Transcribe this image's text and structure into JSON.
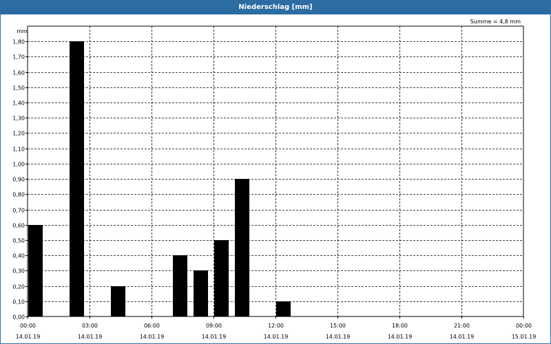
{
  "window": {
    "title": "Niederschlag [mm]"
  },
  "chart_data": {
    "type": "bar",
    "title": "Niederschlag [mm]",
    "annotation": "Summe = 4,8 mm",
    "ylabel": "mm",
    "ylim": [
      0,
      1.9
    ],
    "y_ticks": [
      "0,00",
      "0,10",
      "0,20",
      "0,30",
      "0,40",
      "0,50",
      "0,60",
      "0,70",
      "0,80",
      "0,90",
      "1,00",
      "1,10",
      "1,20",
      "1,30",
      "1,40",
      "1,50",
      "1,60",
      "1,70",
      "1,80"
    ],
    "y_tick_values": [
      0,
      0.1,
      0.2,
      0.3,
      0.4,
      0.5,
      0.6,
      0.7,
      0.8,
      0.9,
      1.0,
      1.1,
      1.2,
      1.3,
      1.4,
      1.5,
      1.6,
      1.7,
      1.8
    ],
    "x_range_hours": [
      0,
      24
    ],
    "x_ticks": [
      {
        "hour": 0,
        "time": "00:00",
        "date": "14.01.19"
      },
      {
        "hour": 3,
        "time": "03:00",
        "date": "14.01.19"
      },
      {
        "hour": 6,
        "time": "06:00",
        "date": "14.01.19"
      },
      {
        "hour": 9,
        "time": "09:00",
        "date": "14.01.19"
      },
      {
        "hour": 12,
        "time": "12:00",
        "date": "14.01.19"
      },
      {
        "hour": 15,
        "time": "15:00",
        "date": "14.01.19"
      },
      {
        "hour": 18,
        "time": "18:00",
        "date": "14.01.19"
      },
      {
        "hour": 21,
        "time": "21:00",
        "date": "14.01.19"
      },
      {
        "hour": 24,
        "time": "00:00",
        "date": "15.01.19"
      }
    ],
    "bars": [
      {
        "hour": 0,
        "value": 0.6
      },
      {
        "hour": 2,
        "value": 1.8
      },
      {
        "hour": 4,
        "value": 0.2
      },
      {
        "hour": 7,
        "value": 0.4
      },
      {
        "hour": 8,
        "value": 0.3
      },
      {
        "hour": 9,
        "value": 0.5
      },
      {
        "hour": 10,
        "value": 0.9
      },
      {
        "hour": 12,
        "value": 0.1
      }
    ],
    "grid": true,
    "bar_color": "#000000"
  }
}
